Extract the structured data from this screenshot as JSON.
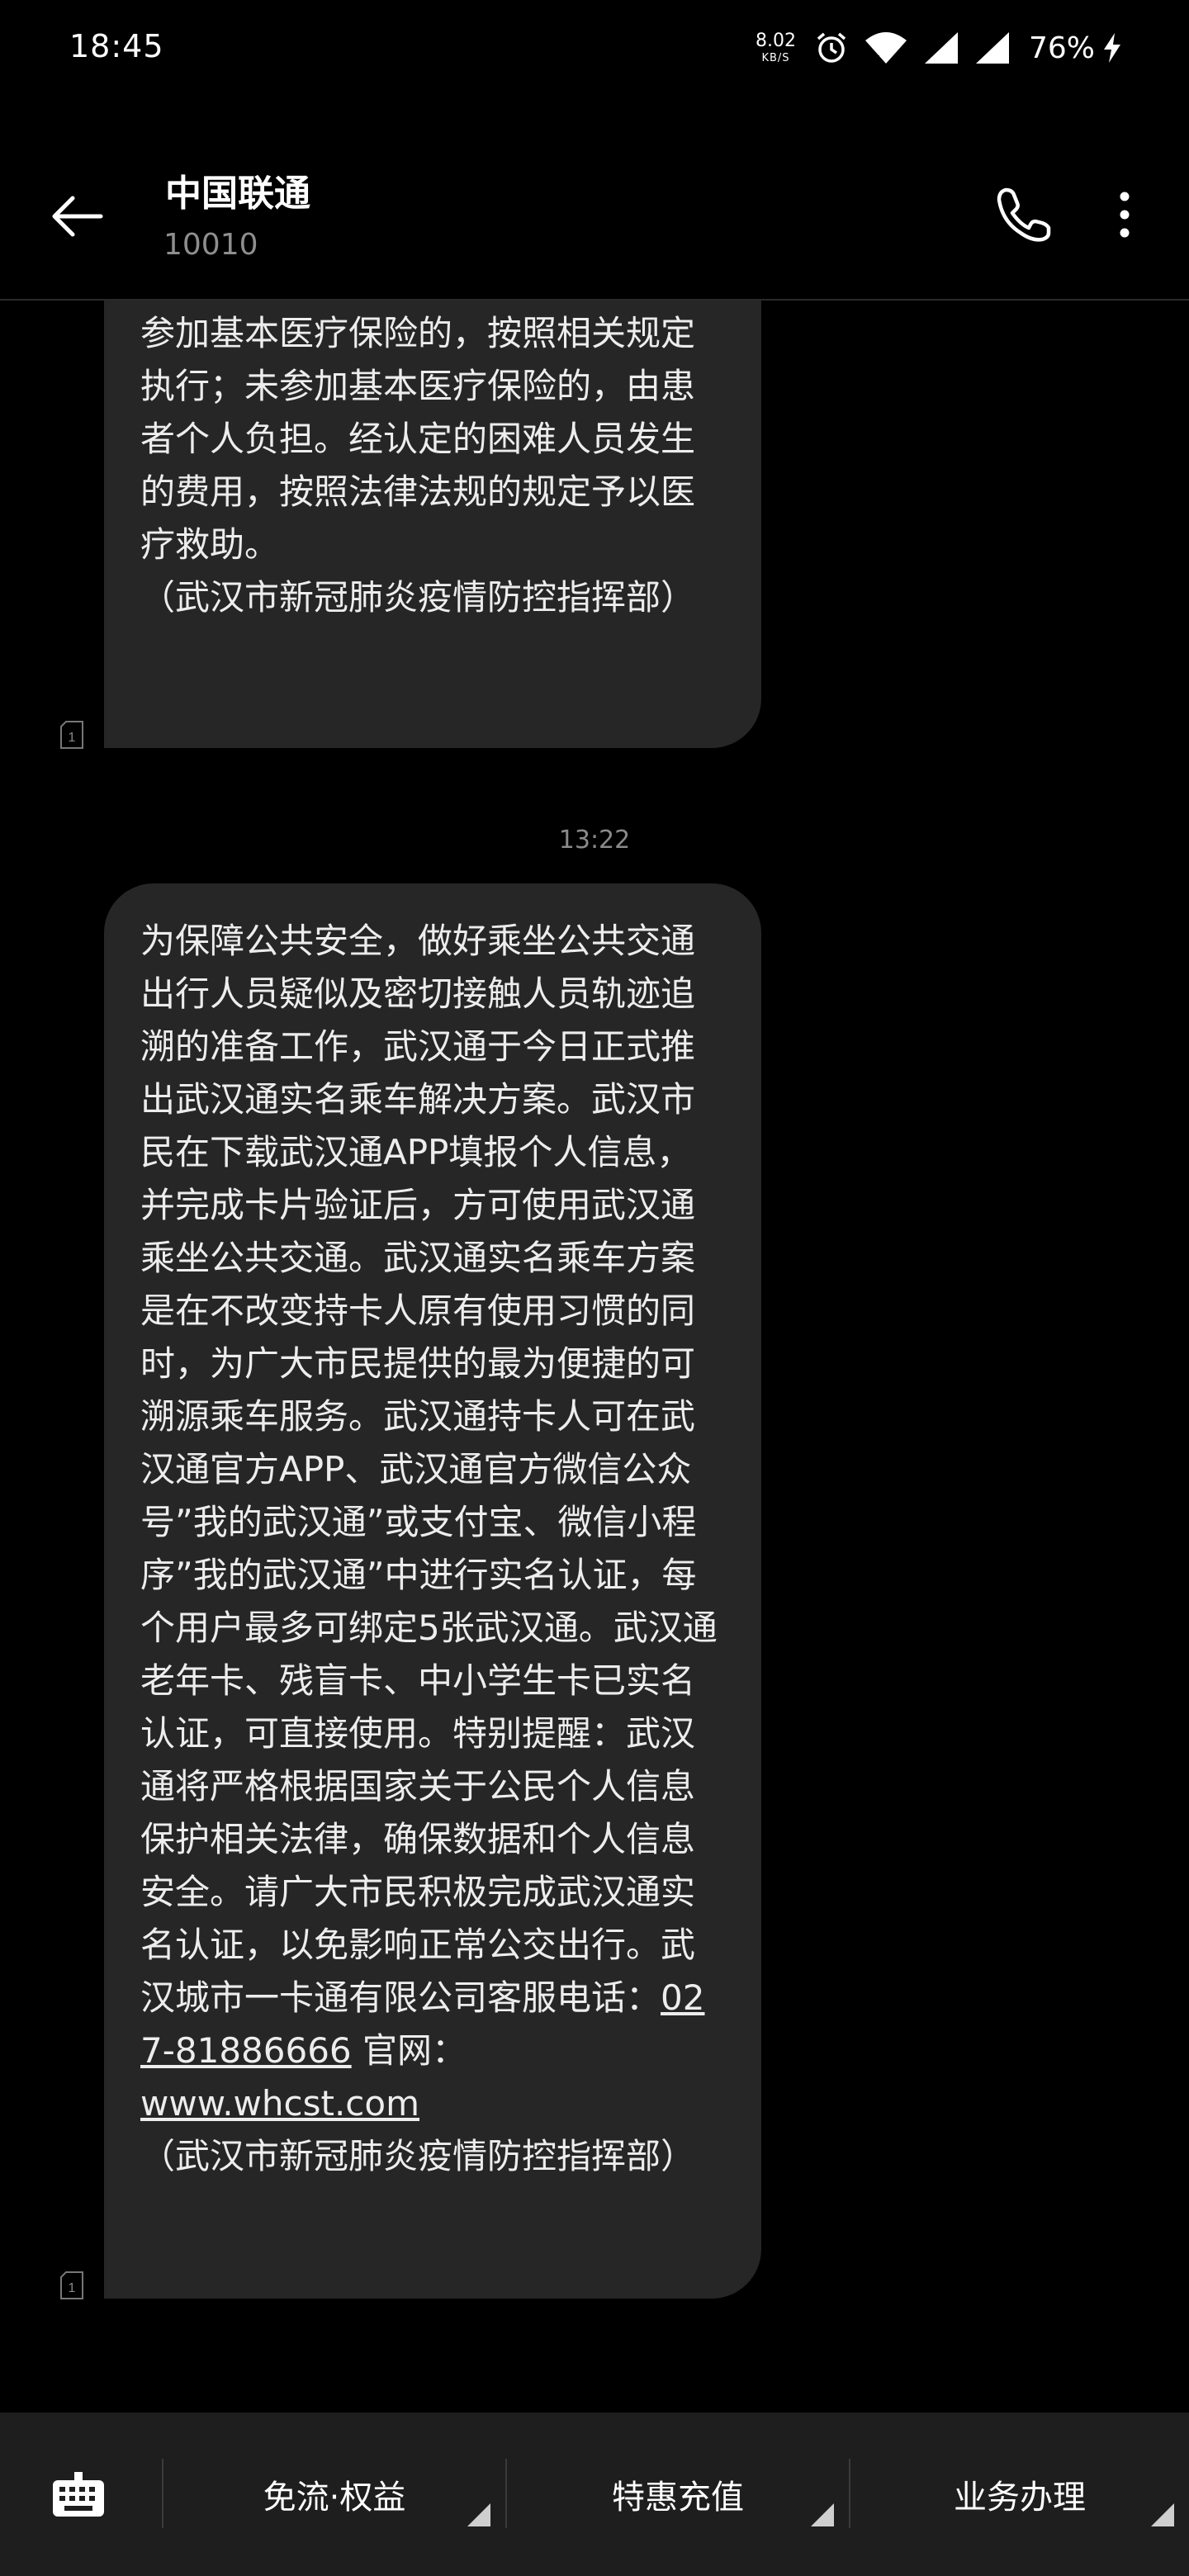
{
  "status_bar": {
    "time": "18:45",
    "net_speed_value": "8.02",
    "net_speed_unit": "KB/S",
    "battery": "76%"
  },
  "header": {
    "contact_name": "中国联通",
    "contact_number": "10010"
  },
  "messages": [
    {
      "lines": [
        "参加基本医疗保险的，按照相关规定执行；未参加基本医疗保险的，由患者个人负担。经认定的困难人员发生的费用，按照法律法规的规定予以医疗救助。",
        "（武汉市新冠肺炎疫情防控指挥部）"
      ],
      "sim_slot": "1"
    },
    {
      "timestamp": "13:22",
      "body": "为保障公共安全，做好乘坐公共交通出行人员疑似及密切接触人员轨迹追溯的准备工作，武汉通于今日正式推出武汉通实名乘车解决方案。武汉市民在下载武汉通APP填报个人信息，并完成卡片验证后，方可使用武汉通乘坐公共交通。武汉通实名乘车方案是在不改变持卡人原有使用习惯的同时，为广大市民提供的最为便捷的可溯源乘车服务。武汉通持卡人可在武汉通官方APP、武汉通官方微信公众号”我的武汉通”或支付宝、微信小程序”我的武汉通”中进行实名认证，每个用户最多可绑定5张武汉通。武汉通老年卡、残盲卡、中小学生卡已实名认证，可直接使用。特别提醒：武汉通将严格根据国家关于公民个人信息保护相关法律，确保数据和个人信息安全。请广大市民积极完成武汉通实名认证，以免影响正常公交出行。武汉城市一卡通有限公司客服电话：",
      "phone_link": "027-81886666",
      "site_prefix": " 官网：",
      "site_link": "www.whcst.com",
      "signature": "（武汉市新冠肺炎疫情防控指挥部）",
      "sim_slot": "1"
    }
  ],
  "bottom_menu": {
    "items": [
      "免流·权益",
      "特惠充值",
      "业务办理"
    ]
  },
  "icons": {
    "back": "arrow-left-icon",
    "call": "phone-icon",
    "more": "more-vert-icon",
    "keyboard": "keyboard-icon",
    "alarm": "alarm-icon",
    "wifi": "wifi-icon",
    "signal": "signal-icon",
    "charging": "charging-icon",
    "sim": "sim-icon"
  },
  "colors": {
    "background": "#000000",
    "bubble": "#262626",
    "secondary_text": "#8e8e8e",
    "bottom_bar": "#1e1e1e"
  }
}
